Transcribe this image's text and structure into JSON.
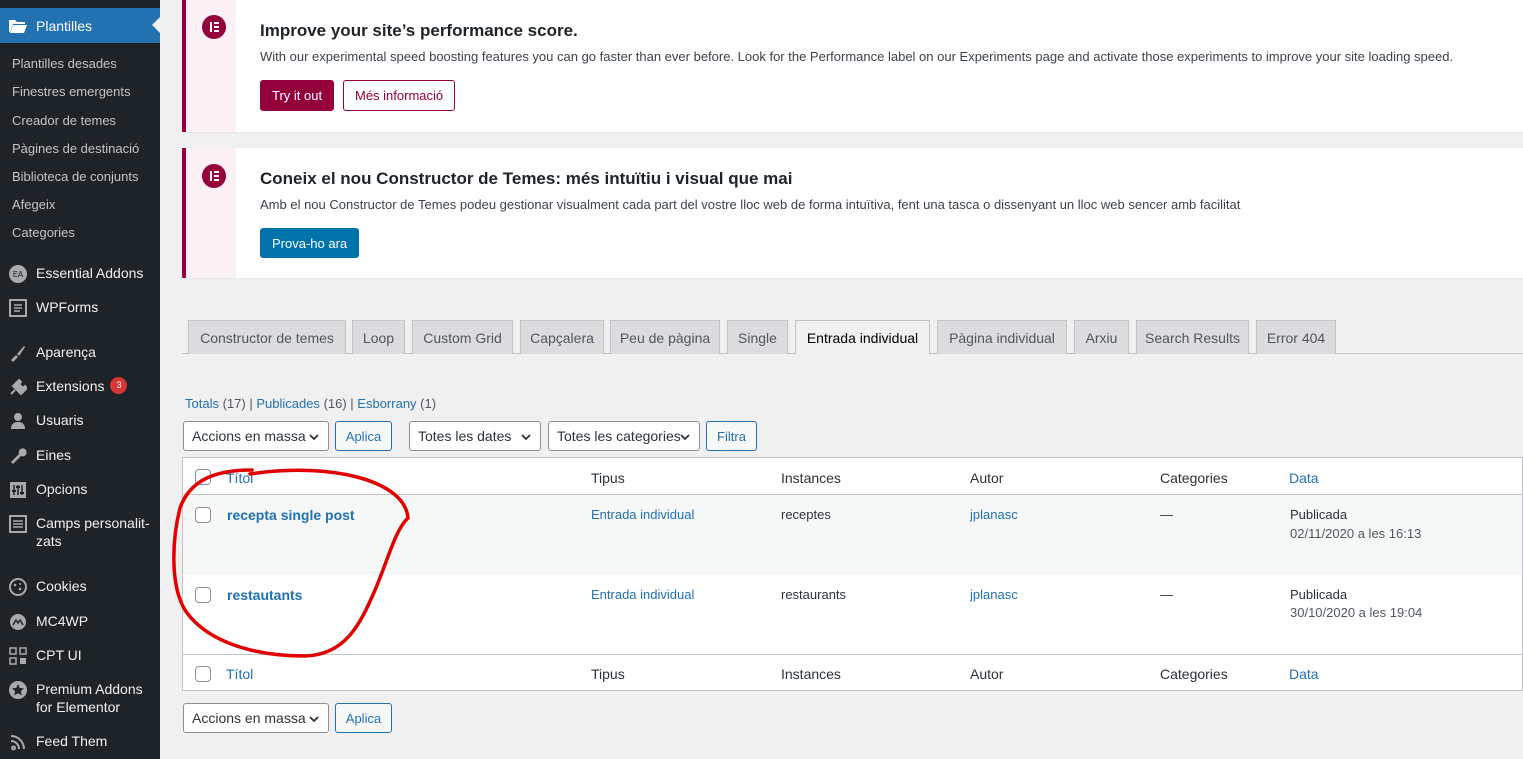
{
  "sidebar": {
    "active": {
      "label": "Plantilles",
      "icon": "folder-open-icon"
    },
    "submenu": [
      "Plantilles desades",
      "Finestres emergents",
      "Creador de temes",
      "Pàgines de destinació",
      "Biblioteca de conjunts",
      "Afegeix",
      "Categories"
    ],
    "items": [
      {
        "label": "Essential Addons",
        "icon": "essential-addons-icon"
      },
      {
        "label": "WPForms",
        "icon": "wpforms-icon"
      },
      {
        "label": "Aparença",
        "icon": "brush-icon"
      },
      {
        "label": "Extensions",
        "icon": "plugin-icon",
        "badge": "3"
      },
      {
        "label": "Usuaris",
        "icon": "user-icon"
      },
      {
        "label": "Eines",
        "icon": "wrench-icon"
      },
      {
        "label": "Opcions",
        "icon": "settings-sliders-icon"
      },
      {
        "label": "Camps personalit-",
        "label2": "zats",
        "icon": "fields-icon"
      },
      {
        "label": "Cookies",
        "icon": "cookie-icon"
      },
      {
        "label": "MC4WP",
        "icon": "mc4wp-icon"
      },
      {
        "label": "CPT UI",
        "icon": "cpt-grid-icon"
      },
      {
        "label": "Premium Addons",
        "label2": "for Elementor",
        "icon": "star-badge-icon"
      },
      {
        "label": "Feed Them",
        "icon": "feed-icon"
      }
    ]
  },
  "notice1": {
    "title": "Improve your site’s performance score.",
    "text": "With our experimental speed boosting features you can go faster than ever before. Look for the Performance label on our Experiments page and activate those experiments to improve your site loading speed.",
    "primary": "Try it out",
    "secondary": "Més informació"
  },
  "notice2": {
    "title": "Coneix el nou Constructor de Temes: més intuïtiu i visual que mai",
    "text": "Amb el nou Constructor de Temes podeu gestionar visualment cada part del vostre lloc web de forma intuïtiva, fent una tasca o dissenyant un lloc web sencer amb facilitat",
    "button": "Prova-ho ara"
  },
  "tabs": [
    "Constructor de temes",
    "Loop",
    "Custom Grid",
    "Capçalera",
    "Peu de pàgina",
    "Single",
    "Entrada individual",
    "Pàgina individual",
    "Arxiu",
    "Search Results",
    "Error 404"
  ],
  "active_tab": "Entrada individual",
  "views": {
    "all": "Totals",
    "all_count": "(17)",
    "published": "Publicades",
    "published_count": "(16)",
    "draft": "Esborrany",
    "draft_count": "(1)"
  },
  "filters": {
    "bulk": "Accions en massa",
    "apply": "Aplica",
    "dates": "Totes les dates",
    "categories": "Totes les categories",
    "filter": "Filtra"
  },
  "columns": {
    "title": "Títol",
    "type": "Tipus",
    "instances": "Instances",
    "author": "Autor",
    "categories": "Categories",
    "date": "Data"
  },
  "rows": [
    {
      "title": "recepta single post",
      "type": "Entrada individual",
      "instances": "receptes",
      "author": "jplanasc",
      "categories": "—",
      "status": "Publicada",
      "date": "02/11/2020 a les 16:13"
    },
    {
      "title": "restautants",
      "type": "Entrada individual",
      "instances": "restaurants",
      "author": "jplanasc",
      "categories": "—",
      "status": "Publicada",
      "date": "30/10/2020 a les 19:04"
    }
  ],
  "colors": {
    "sidebar_bg": "#1d2327",
    "active_blue": "#2271b1",
    "elementor": "#93003c",
    "annotation_red": "#e00000"
  }
}
